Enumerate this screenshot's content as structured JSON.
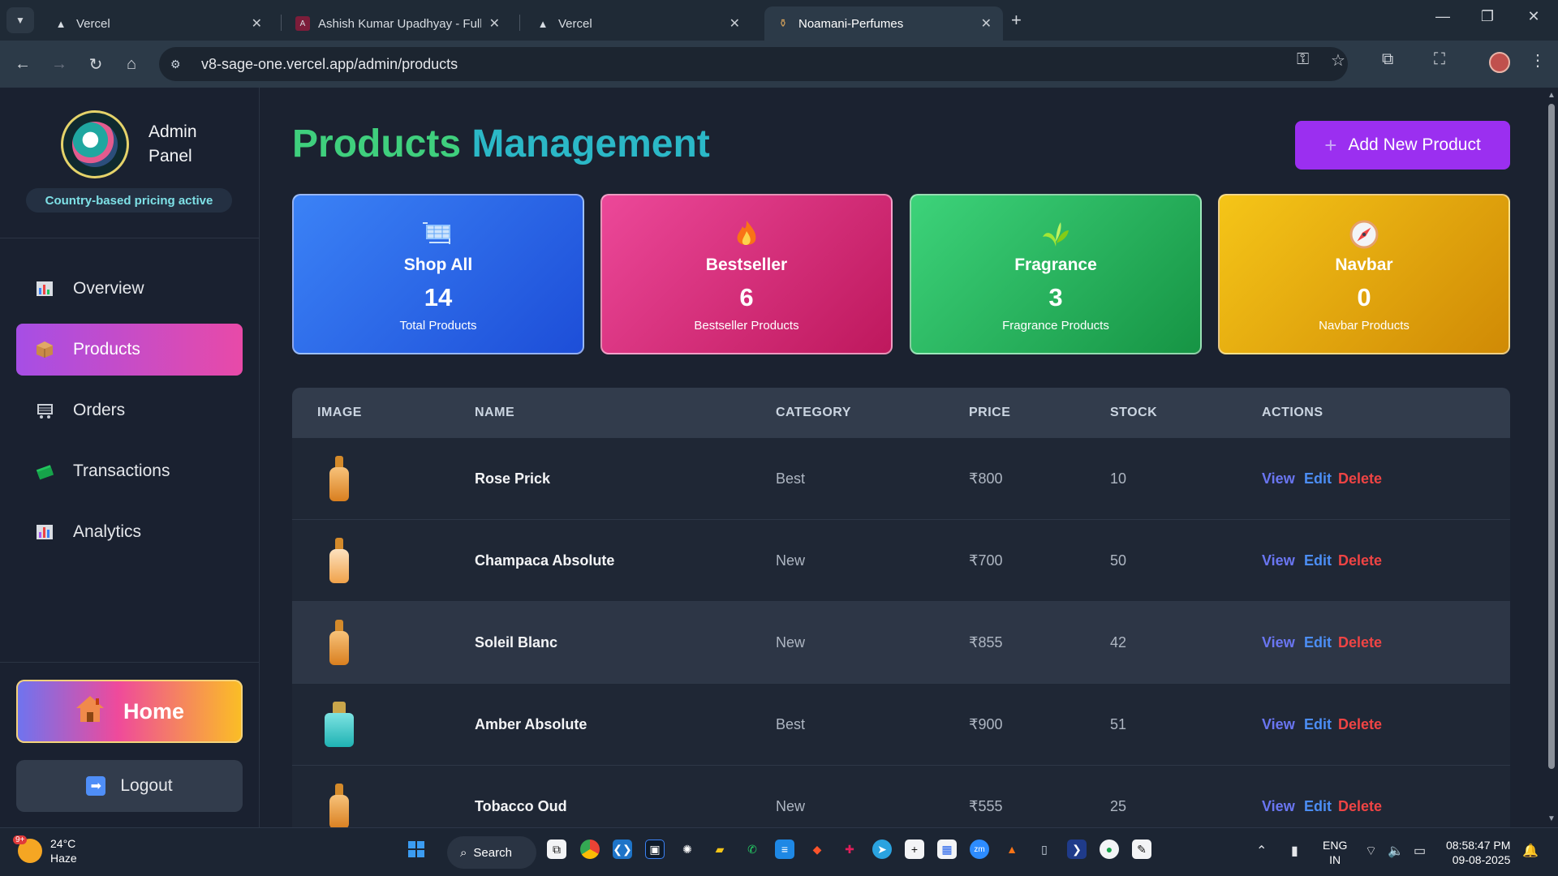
{
  "browser": {
    "tabs": [
      {
        "title": "Vercel",
        "icon": "vercel-icon"
      },
      {
        "title": "Ashish Kumar Upadhyay - Full S",
        "icon": "portfolio-icon"
      },
      {
        "title": "Vercel",
        "icon": "vercel-icon"
      },
      {
        "title": "Noamani-Perfumes",
        "icon": "perfume-icon",
        "active": true
      }
    ],
    "url": "v8-sage-one.vercel.app/admin/products"
  },
  "sidebar": {
    "brand": "Admin Panel",
    "pricing_badge": "Country-based pricing active",
    "nav": [
      {
        "label": "Overview",
        "icon": "chart-icon"
      },
      {
        "label": "Products",
        "icon": "package-icon",
        "active": true
      },
      {
        "label": "Orders",
        "icon": "cart-icon"
      },
      {
        "label": "Transactions",
        "icon": "money-icon"
      },
      {
        "label": "Analytics",
        "icon": "bar-chart-icon"
      }
    ],
    "home_label": "Home",
    "logout_label": "Logout"
  },
  "main": {
    "title_part1": "Products",
    "title_part2": "Management",
    "add_button": "Add New Product"
  },
  "stats": [
    {
      "label": "Shop All",
      "value": "14",
      "sub": "Total Products",
      "icon": "cart-icon",
      "color": "#3b82f6"
    },
    {
      "label": "Bestseller",
      "value": "6",
      "sub": "Bestseller Products",
      "icon": "fire-icon",
      "color": "#ec4899"
    },
    {
      "label": "Fragrance",
      "value": "3",
      "sub": "Fragrance Products",
      "icon": "leaf-icon",
      "color": "#22c55e"
    },
    {
      "label": "Navbar",
      "value": "0",
      "sub": "Navbar Products",
      "icon": "compass-icon",
      "color": "#eab308"
    }
  ],
  "table": {
    "headers": [
      "IMAGE",
      "NAME",
      "CATEGORY",
      "PRICE",
      "STOCK",
      "ACTIONS"
    ],
    "actions": {
      "view": "View",
      "edit": "Edit",
      "delete": "Delete"
    },
    "rows": [
      {
        "name": "Rose Prick",
        "category": "Best",
        "price": "₹800",
        "stock": "10"
      },
      {
        "name": "Champaca Absolute",
        "category": "New",
        "price": "₹700",
        "stock": "50"
      },
      {
        "name": "Soleil Blanc",
        "category": "New",
        "price": "₹855",
        "stock": "42"
      },
      {
        "name": "Amber Absolute",
        "category": "Best",
        "price": "₹900",
        "stock": "51"
      },
      {
        "name": "Tobacco Oud",
        "category": "New",
        "price": "₹555",
        "stock": "25"
      }
    ]
  },
  "taskbar": {
    "weather_temp": "24°C",
    "weather_desc": "Haze",
    "weather_badge": "9+",
    "search_label": "Search",
    "lang_line1": "ENG",
    "lang_line2": "IN",
    "time": "08:58:47 PM",
    "date": "09-08-2025"
  }
}
